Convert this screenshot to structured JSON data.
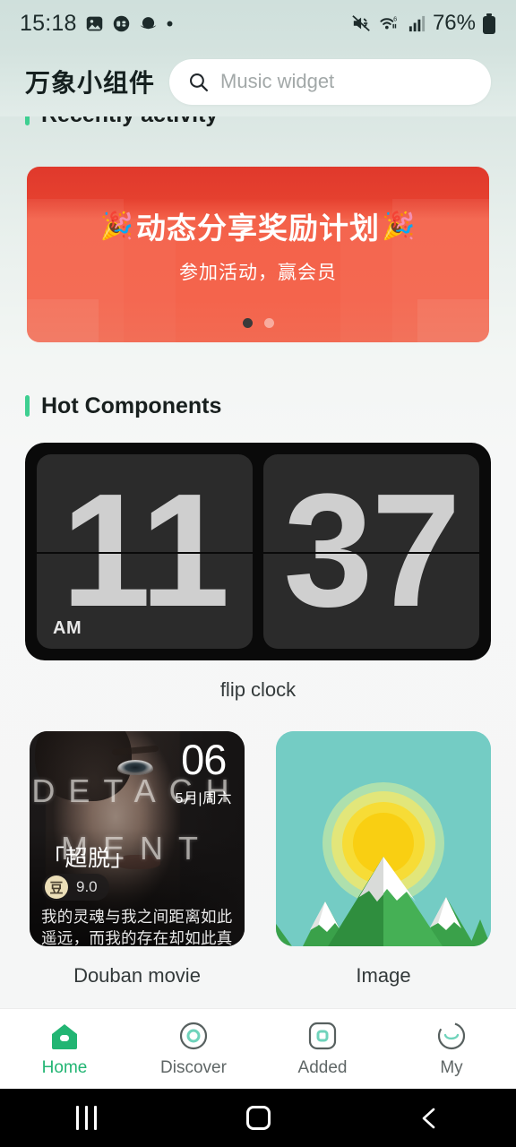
{
  "status_bar": {
    "time": "15:18",
    "battery_percent": "76%",
    "left_icons": [
      "photo-icon",
      "app-badge-icon",
      "planet-icon",
      "dot-icon"
    ],
    "right_icons": [
      "mute-icon",
      "wifi-6-icon",
      "signal-icon",
      "battery-icon"
    ]
  },
  "header": {
    "app_title": "万象小组件",
    "search_placeholder": "Music widget"
  },
  "sections": {
    "recent": {
      "title": "Recently activity"
    },
    "hot": {
      "title": "Hot Components"
    }
  },
  "banner": {
    "emoji_left": "🎉",
    "emoji_right": "🎉",
    "title": "动态分享奖励计划",
    "subtitle": "参加活动，赢会员",
    "dots": 2,
    "active_dot": 0,
    "bg_color": "#f4624a"
  },
  "widgets": {
    "flip_clock": {
      "label": "flip clock",
      "hours": "11",
      "minutes": "37",
      "ampm": "AM",
      "bg_color": "#0a0a0a",
      "digit_color": "#cfcfcf"
    },
    "douban": {
      "label": "Douban movie",
      "day": "06",
      "month_weekday": "5月|周六",
      "chalk_line1": "DETACH",
      "chalk_line2": "MENT",
      "title": "「超脱」",
      "bean_glyph": "豆",
      "score": "9.0",
      "quote": "我的灵魂与我之间距离如此遥远，而我的存在却如此真实。"
    },
    "image": {
      "label": "Image",
      "sky_color": "#74ccc4",
      "sun_color": "#f5cf1e",
      "mountain_color": "#3aa14a",
      "snow_color": "#ffffff"
    }
  },
  "tabbar": {
    "items": [
      {
        "label": "Home",
        "icon": "home-icon",
        "active": true
      },
      {
        "label": "Discover",
        "icon": "compass-circle-icon",
        "active": false
      },
      {
        "label": "Added",
        "icon": "square-added-icon",
        "active": false
      },
      {
        "label": "My",
        "icon": "profile-icon",
        "active": false
      }
    ],
    "active_color": "#22b573"
  },
  "navbar": {
    "recents": "recents-icon",
    "home": "home-circle-icon",
    "back": "back-icon"
  }
}
